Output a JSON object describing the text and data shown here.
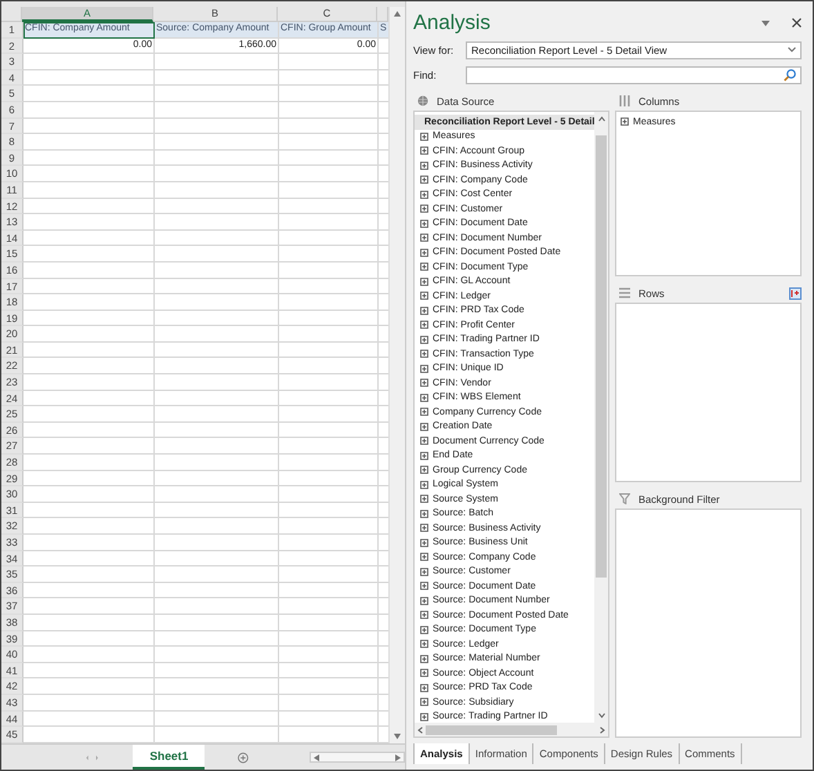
{
  "sheet": {
    "columns": [
      {
        "letter": "A",
        "selected": true
      },
      {
        "letter": "B",
        "selected": false
      },
      {
        "letter": "C",
        "selected": false
      },
      {
        "selected": false
      }
    ],
    "rows": [
      {
        "number": "1",
        "kind": "header",
        "cells": [
          "CFIN: Company Amount",
          "Source: Company Amount",
          "CFIN: Group Amount",
          "S"
        ]
      },
      {
        "number": "2",
        "kind": "value",
        "cells": [
          "0.00",
          "1,660.00",
          "0.00"
        ]
      },
      {
        "number": "3"
      },
      {
        "number": "4"
      },
      {
        "number": "5"
      },
      {
        "number": "6"
      },
      {
        "number": "7"
      },
      {
        "number": "8"
      },
      {
        "number": "9"
      },
      {
        "number": "10"
      },
      {
        "number": "11"
      },
      {
        "number": "12"
      },
      {
        "number": "13"
      },
      {
        "number": "14"
      },
      {
        "number": "15"
      },
      {
        "number": "16"
      },
      {
        "number": "17"
      },
      {
        "number": "18"
      },
      {
        "number": "19"
      },
      {
        "number": "20"
      },
      {
        "number": "21"
      },
      {
        "number": "22"
      },
      {
        "number": "23"
      },
      {
        "number": "24"
      },
      {
        "number": "25"
      },
      {
        "number": "26"
      },
      {
        "number": "27"
      },
      {
        "number": "28"
      },
      {
        "number": "29"
      },
      {
        "number": "30"
      },
      {
        "number": "31"
      },
      {
        "number": "32"
      },
      {
        "number": "33"
      },
      {
        "number": "34"
      },
      {
        "number": "35"
      },
      {
        "number": "36"
      },
      {
        "number": "37"
      },
      {
        "number": "38"
      },
      {
        "number": "39"
      },
      {
        "number": "40"
      },
      {
        "number": "41"
      },
      {
        "number": "42"
      },
      {
        "number": "43"
      },
      {
        "number": "44"
      },
      {
        "number": "45"
      }
    ],
    "sheet_tabs": [
      {
        "label": "Sheet1",
        "selected": true
      }
    ]
  },
  "pane": {
    "title": "Analysis",
    "view_for": {
      "label": "View for:",
      "value": "Reconciliation Report Level - 5 Detail View"
    },
    "find": {
      "label": "Find:"
    },
    "data_source": {
      "title": "Data Source",
      "items": [
        {
          "label": "Reconciliation Report Level - 5 Detail",
          "kind": "source",
          "selected": true
        },
        {
          "label": "Measures",
          "kind": "field",
          "selected": false
        },
        {
          "label": "CFIN: Account Group",
          "kind": "field",
          "selected": false
        },
        {
          "label": "CFIN: Business Activity",
          "kind": "field",
          "selected": false
        },
        {
          "label": "CFIN: Company Code",
          "kind": "field",
          "selected": false
        },
        {
          "label": "CFIN: Cost Center",
          "kind": "field",
          "selected": false
        },
        {
          "label": "CFIN: Customer",
          "kind": "field",
          "selected": false
        },
        {
          "label": "CFIN: Document Date",
          "kind": "field",
          "selected": false
        },
        {
          "label": "CFIN: Document Number",
          "kind": "field",
          "selected": false
        },
        {
          "label": "CFIN: Document Posted Date",
          "kind": "field",
          "selected": false
        },
        {
          "label": "CFIN: Document Type",
          "kind": "field",
          "selected": false
        },
        {
          "label": "CFIN: GL Account",
          "kind": "field",
          "selected": false
        },
        {
          "label": "CFIN: Ledger",
          "kind": "field",
          "selected": false
        },
        {
          "label": "CFIN: PRD Tax Code",
          "kind": "field",
          "selected": false
        },
        {
          "label": "CFIN: Profit Center",
          "kind": "field",
          "selected": false
        },
        {
          "label": "CFIN: Trading Partner ID",
          "kind": "field",
          "selected": false
        },
        {
          "label": "CFIN: Transaction Type",
          "kind": "field",
          "selected": false
        },
        {
          "label": "CFIN: Unique ID",
          "kind": "field",
          "selected": false
        },
        {
          "label": "CFIN: Vendor",
          "kind": "field",
          "selected": false
        },
        {
          "label": "CFIN: WBS Element",
          "kind": "field",
          "selected": false
        },
        {
          "label": "Company Currency Code",
          "kind": "field",
          "selected": false
        },
        {
          "label": "Creation Date",
          "kind": "field",
          "selected": false
        },
        {
          "label": "Document Currency Code",
          "kind": "field",
          "selected": false
        },
        {
          "label": "End Date",
          "kind": "field",
          "selected": false
        },
        {
          "label": "Group Currency Code",
          "kind": "field",
          "selected": false
        },
        {
          "label": "Logical System",
          "kind": "field",
          "selected": false
        },
        {
          "label": "Source System",
          "kind": "field",
          "selected": false
        },
        {
          "label": "Source: Batch",
          "kind": "field",
          "selected": false
        },
        {
          "label": "Source: Business Activity",
          "kind": "field",
          "selected": false
        },
        {
          "label": "Source: Business Unit",
          "kind": "field",
          "selected": false
        },
        {
          "label": "Source: Company Code",
          "kind": "field",
          "selected": false
        },
        {
          "label": "Source: Customer",
          "kind": "field",
          "selected": false
        },
        {
          "label": "Source: Document Date",
          "kind": "field",
          "selected": false
        },
        {
          "label": "Source: Document Number",
          "kind": "field",
          "selected": false
        },
        {
          "label": "Source: Document Posted Date",
          "kind": "field",
          "selected": false
        },
        {
          "label": "Source: Document Type",
          "kind": "field",
          "selected": false
        },
        {
          "label": "Source: Ledger",
          "kind": "field",
          "selected": false
        },
        {
          "label": "Source: Material Number",
          "kind": "field",
          "selected": false
        },
        {
          "label": "Source: Object Account",
          "kind": "field",
          "selected": false
        },
        {
          "label": "Source: PRD Tax Code",
          "kind": "field",
          "selected": false
        },
        {
          "label": "Source: Subsidiary",
          "kind": "field",
          "selected": false
        },
        {
          "label": "Source: Trading Partner ID",
          "kind": "field",
          "selected": false
        }
      ]
    },
    "columns": {
      "title": "Columns",
      "items": [
        {
          "label": "Measures"
        }
      ]
    },
    "rows": {
      "title": "Rows"
    },
    "background_filter": {
      "title": "Background Filter"
    },
    "tabs": [
      {
        "label": "Analysis",
        "selected": true
      },
      {
        "label": "Information",
        "selected": false
      },
      {
        "label": "Components",
        "selected": false
      },
      {
        "label": "Design Rules",
        "selected": false
      },
      {
        "label": "Comments",
        "selected": false
      }
    ]
  }
}
